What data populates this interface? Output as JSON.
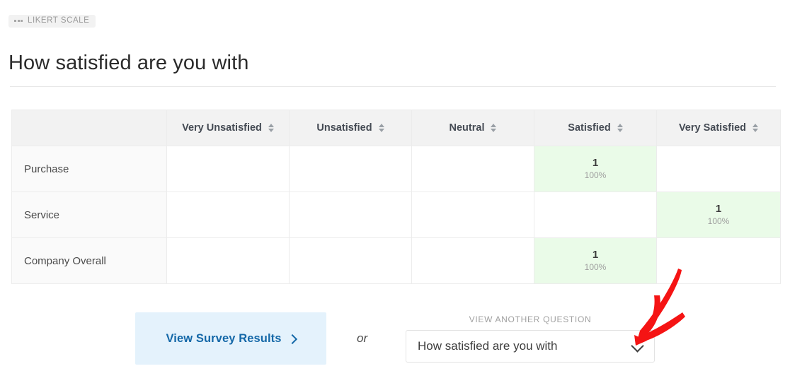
{
  "badge": {
    "icon": "grid-dots-icon",
    "label": "LIKERT SCALE"
  },
  "page_title": "How satisfied are you with",
  "table": {
    "corner_header": "",
    "columns": [
      "Very Unsatisfied",
      "Unsatisfied",
      "Neutral",
      "Satisfied",
      "Very Satisfied"
    ],
    "sort_icon": "sort-updown-icon",
    "rows": [
      {
        "label": "Purchase",
        "cells": [
          {
            "count": "",
            "percent": "",
            "filled": false
          },
          {
            "count": "",
            "percent": "",
            "filled": false
          },
          {
            "count": "",
            "percent": "",
            "filled": false
          },
          {
            "count": "1",
            "percent": "100%",
            "filled": true
          },
          {
            "count": "",
            "percent": "",
            "filled": false
          }
        ]
      },
      {
        "label": "Service",
        "cells": [
          {
            "count": "",
            "percent": "",
            "filled": false
          },
          {
            "count": "",
            "percent": "",
            "filled": false
          },
          {
            "count": "",
            "percent": "",
            "filled": false
          },
          {
            "count": "",
            "percent": "",
            "filled": false
          },
          {
            "count": "1",
            "percent": "100%",
            "filled": true
          }
        ]
      },
      {
        "label": "Company Overall",
        "cells": [
          {
            "count": "",
            "percent": "",
            "filled": false
          },
          {
            "count": "",
            "percent": "",
            "filled": false
          },
          {
            "count": "",
            "percent": "",
            "filled": false
          },
          {
            "count": "1",
            "percent": "100%",
            "filled": true
          },
          {
            "count": "",
            "percent": "",
            "filled": false
          }
        ]
      }
    ]
  },
  "footer": {
    "results_button_label": "View Survey Results",
    "results_button_icon": "chevron-right-icon",
    "or_label": "or",
    "select_caption": "VIEW ANOTHER QUESTION",
    "select_value": "How satisfied are you with",
    "select_icon": "chevron-down-icon"
  },
  "annotation": {
    "arrow_icon": "red-arrow-annotation",
    "color": "#f51414"
  },
  "colors": {
    "highlight_cell": "#eafbe8",
    "button_bg": "#e4f2fc",
    "button_text": "#1468a8",
    "header_bg": "#f2f2f2",
    "row_label_bg": "#fafafa",
    "annotation_red": "#f51414"
  }
}
